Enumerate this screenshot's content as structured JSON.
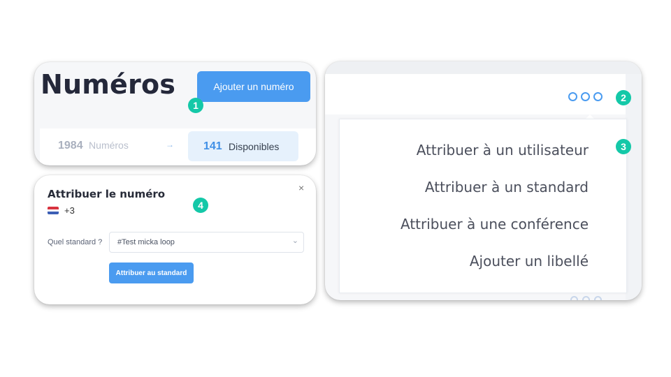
{
  "card1": {
    "title": "Numéros",
    "add_button": "Ajouter un numéro",
    "stats": {
      "total_count": "1984",
      "total_label": "Numéros",
      "arrow": "→",
      "available_count": "141",
      "available_label": "Disponibles"
    }
  },
  "card2": {
    "title": "Attribuer le numéro",
    "phone": "+3",
    "field_label": "Quel standard ?",
    "select_value": "#Test micka loop",
    "assign_button": "Attribuer au standard",
    "close": "×",
    "chevron": "⌄"
  },
  "card3": {
    "menu": [
      "Attribuer à un utilisateur",
      "Attribuer à un standard",
      "Attribuer à une conférence",
      "Ajouter un libellé"
    ]
  },
  "badges": [
    "1",
    "2",
    "3",
    "4"
  ],
  "colors": {
    "accent": "#4a9bf0",
    "badge": "#14c8a8",
    "flag": [
      "#d8333f",
      "#ffffff",
      "#3c5fb5"
    ]
  }
}
